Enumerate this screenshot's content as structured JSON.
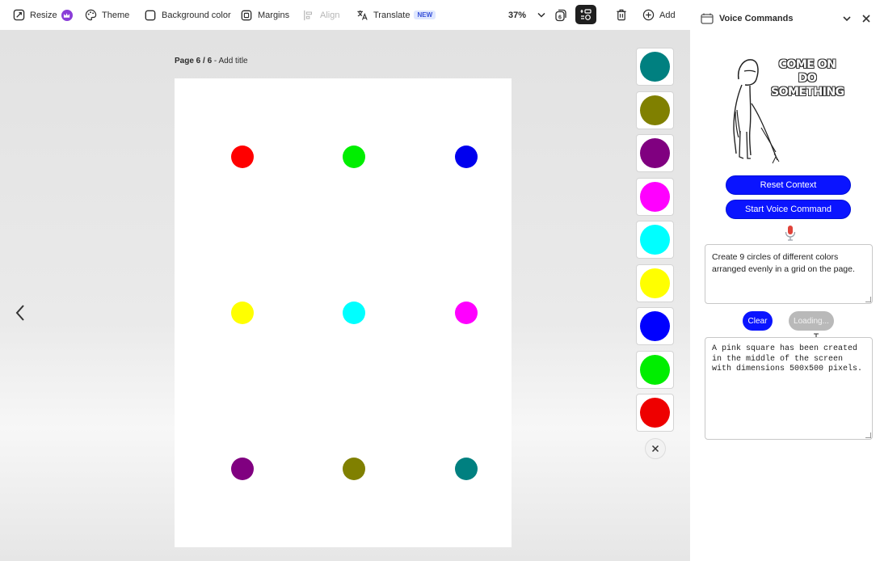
{
  "toolbar": {
    "resize": "Resize",
    "theme": "Theme",
    "background_color": "Background color",
    "margins": "Margins",
    "align": "Align",
    "translate": "Translate",
    "translate_badge": "NEW",
    "zoom": "37%",
    "add": "Add"
  },
  "page": {
    "page_number": "Page 6 / 6",
    "title_placeholder": " - Add title"
  },
  "canvas": {
    "circles": [
      {
        "color": "#ff0000"
      },
      {
        "color": "#00ee00"
      },
      {
        "color": "#0000ee"
      },
      {
        "color": "#ffff00"
      },
      {
        "color": "#00ffff"
      },
      {
        "color": "#ff00ff"
      },
      {
        "color": "#800080"
      },
      {
        "color": "#808000"
      },
      {
        "color": "#008080"
      }
    ]
  },
  "swatches": [
    {
      "color": "#008080"
    },
    {
      "color": "#808000"
    },
    {
      "color": "#800080"
    },
    {
      "color": "#ff00ff"
    },
    {
      "color": "#00ffff"
    },
    {
      "color": "#ffff00"
    },
    {
      "color": "#0000ff"
    },
    {
      "color": "#00ee00"
    },
    {
      "color": "#ee0000"
    }
  ],
  "panel": {
    "title": "Voice Commands",
    "meme_text": "COME ON DO SOMETHING",
    "reset_button": "Reset Context",
    "start_button": "Start Voice Command",
    "prompt_text": "Create 9 circles of different colors arranged evenly in a grid on the page.",
    "clear_button": "Clear",
    "loading_button": "Loading...",
    "response_text": "A pink square has been created in the middle of the screen with dimensions 500x500 pixels."
  },
  "colors": {
    "accent_blue": "#0a14ff",
    "mic_red": "#e0433a"
  }
}
